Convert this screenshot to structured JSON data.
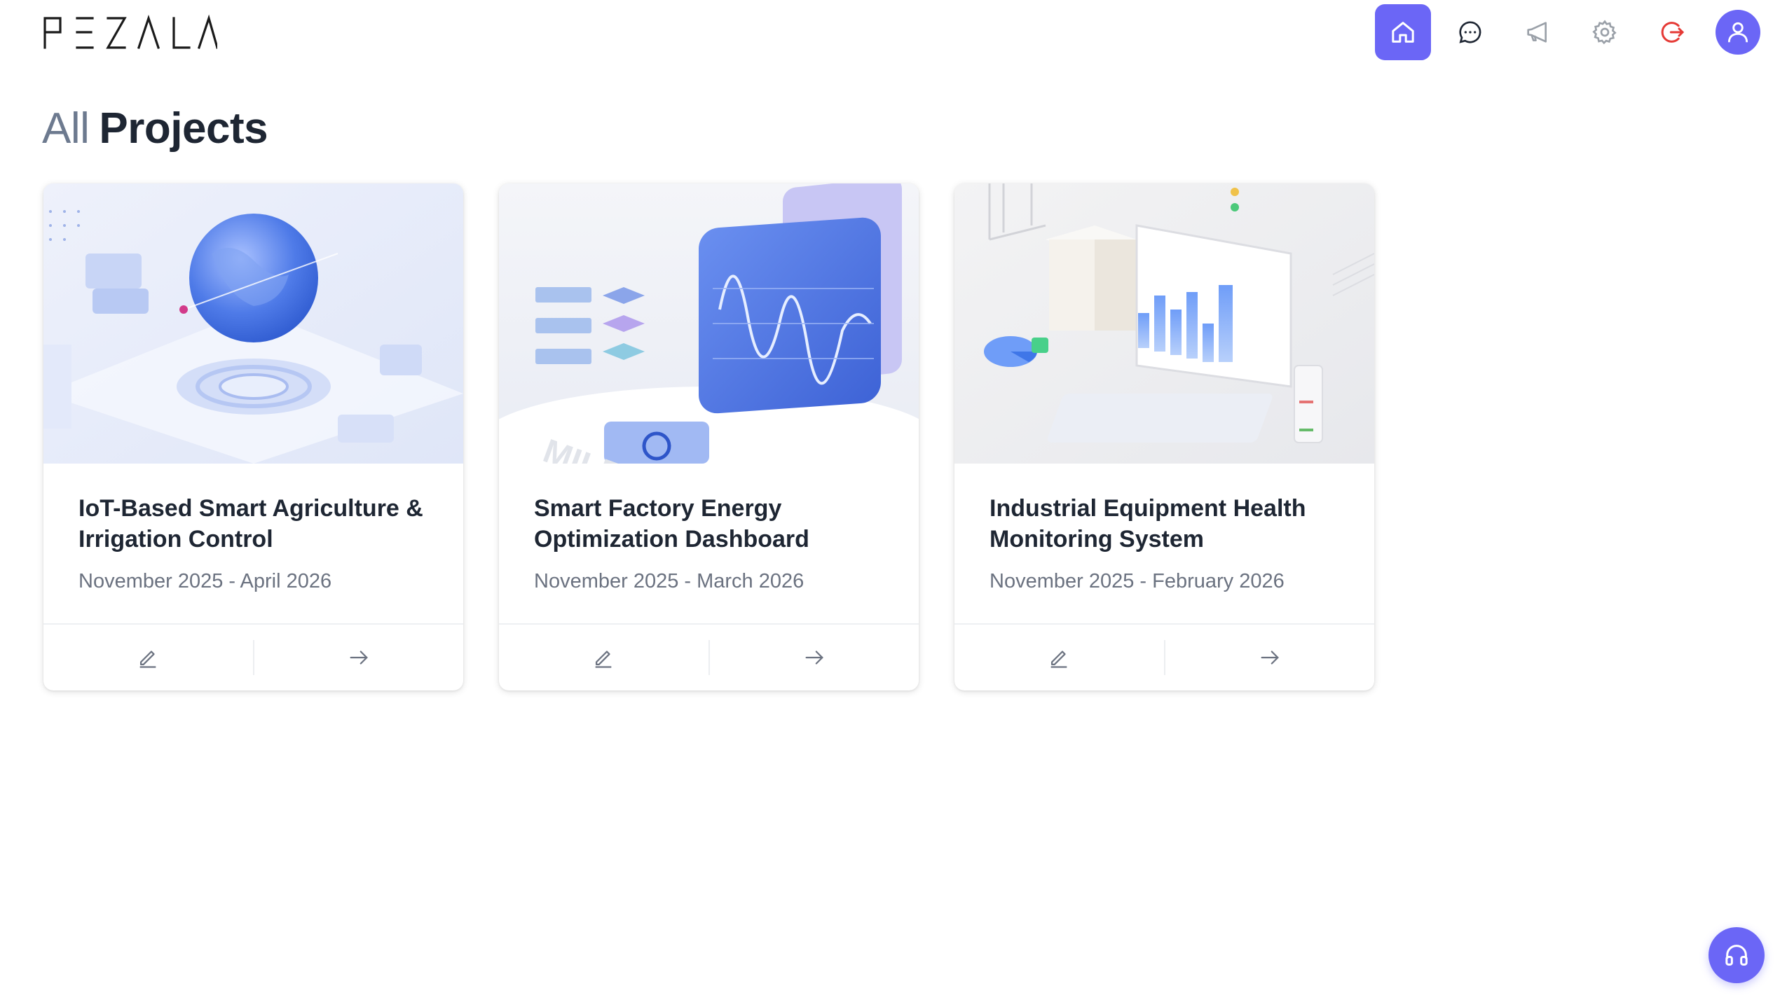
{
  "app": {
    "logo_text": "PEZALA"
  },
  "nav": {
    "items": [
      {
        "icon": "home-icon",
        "active": true
      },
      {
        "icon": "chat-icon",
        "active": false
      },
      {
        "icon": "megaphone-icon",
        "active": false
      },
      {
        "icon": "gear-icon",
        "active": false
      },
      {
        "icon": "logout-icon",
        "active": false
      },
      {
        "icon": "user-icon",
        "active": false
      }
    ]
  },
  "page": {
    "title_prefix": "All",
    "title_main": "Projects"
  },
  "projects": [
    {
      "title": "IoT-Based Smart Agriculture & Irrigation Control",
      "dates": "November 2025 - April 2026"
    },
    {
      "title": "Smart Factory Energy Optimization Dashboard",
      "dates": "November 2025 - March 2026"
    },
    {
      "title": "Industrial Equipment Health Monitoring System",
      "dates": "November 2025 - February 2026"
    }
  ],
  "colors": {
    "accent": "#6b66f6",
    "logout": "#e53935",
    "text": "#1e2633",
    "muted": "#6b7280"
  }
}
